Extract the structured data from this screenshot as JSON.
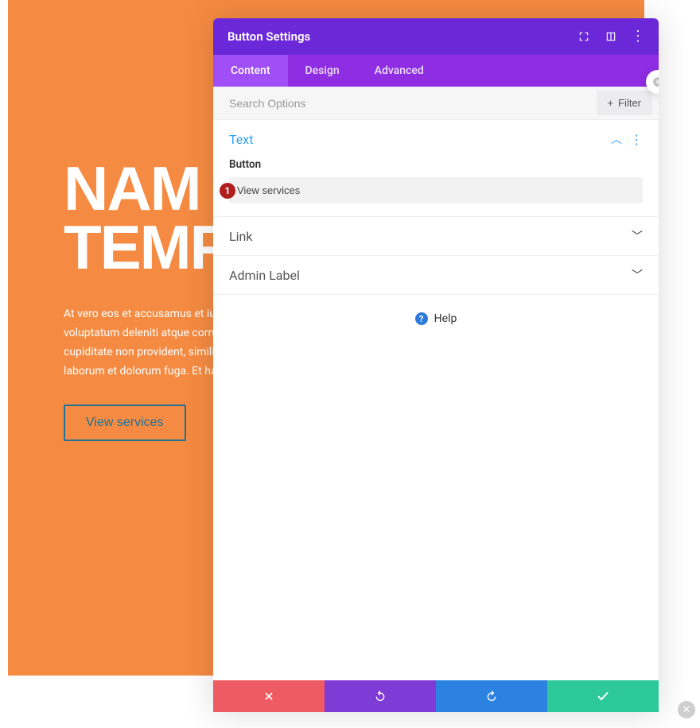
{
  "page": {
    "hero_title_line1": "NAM",
    "hero_title_line2": "TEMP",
    "hero_paragraph": "At vero eos et accusamus et iusto voluptatum deleniti atque corrupt cupiditate non provident, similique laborum et dolorum fuga. Et harum",
    "hero_button": "View services"
  },
  "modal": {
    "title": "Button Settings",
    "tabs": {
      "content": "Content",
      "design": "Design",
      "advanced": "Advanced"
    },
    "search_placeholder": "Search Options",
    "filter_label": "Filter",
    "sections": {
      "text": {
        "title": "Text",
        "field_label": "Button",
        "field_value": "View services",
        "marker": "1"
      },
      "link": {
        "title": "Link"
      },
      "admin": {
        "title": "Admin Label"
      }
    },
    "help_label": "Help"
  }
}
